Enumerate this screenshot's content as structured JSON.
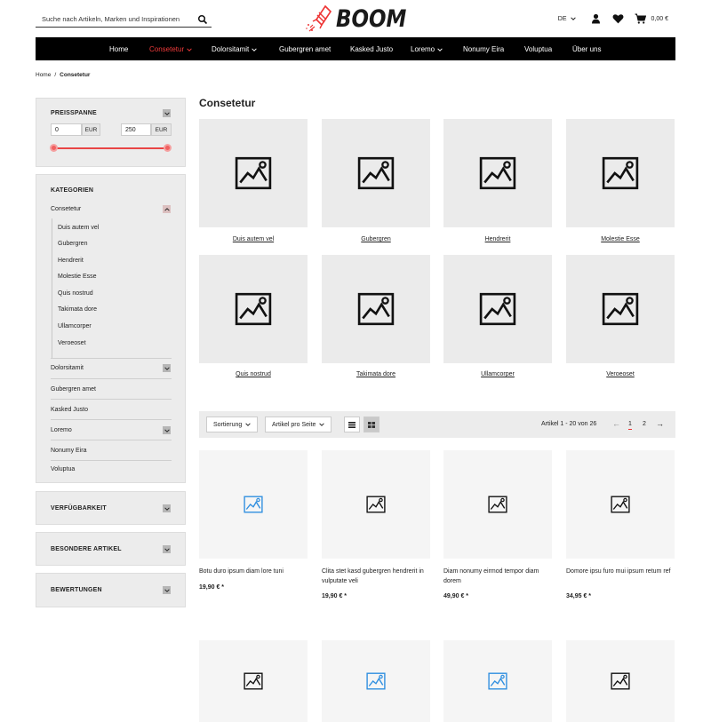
{
  "header": {
    "search_placeholder": "Suche nach Artikeln, Marken und Inspirationen",
    "logo_text": "BOOM",
    "language": "DE",
    "cart_total": "0,00 €"
  },
  "nav": {
    "items": [
      "Home",
      "Consetetur",
      "Dolorsitamit",
      "Gubergren amet",
      "Kasked Justo",
      "Loremo",
      "Nonumy Eira",
      "Voluptua",
      "Über uns"
    ]
  },
  "breadcrumb": {
    "home": "Home",
    "separator": "/",
    "current": "Consetetur"
  },
  "sidebar": {
    "price": {
      "title": "PREISSPANNE",
      "min": "0",
      "max": "250",
      "unit": "EUR",
      "range_fraction": [
        0,
        1
      ]
    },
    "categories": {
      "title": "KATEGORIEN",
      "active": "Consetetur",
      "sub_items": [
        "Duis autem vel",
        "Gubergren",
        "Hendrerit",
        "Molestie Esse",
        "Quis nostrud",
        "Takimata dore",
        "Ullamcorper",
        "Veroeoset"
      ],
      "items": [
        "Dolorsitamit",
        "Gubergren amet",
        "Kasked Justo",
        "Loremo",
        "Nonumy Eira",
        "Voluptua"
      ]
    },
    "filters": [
      "VERFÜGBARKEIT",
      "BESONDERE ARTIKEL",
      "BEWERTUNGEN"
    ]
  },
  "main": {
    "title": "Consetetur",
    "subcategories": [
      "Duis autem vel",
      "Gubergren",
      "Hendrerit",
      "Molestie Esse",
      "Quis nostrud",
      "Takimata dore",
      "Ullamcorper",
      "Veroeoset"
    ],
    "toolbar": {
      "sort_label": "Sortierung",
      "per_page_label": "Artikel pro Seite",
      "count_text": "Artikel 1 - 20 von 26",
      "pages": [
        "1",
        "2"
      ],
      "current_page": "1"
    },
    "products": [
      {
        "name": "Botu duro ipsum diam lore tuni",
        "price": "19,90 € *"
      },
      {
        "name": "Clita stet kasd gubergren hendrerit in vulputate veli",
        "price": "19,90 € *"
      },
      {
        "name": "Diam nonumy eirmod tempor diam dorem",
        "price": "49,90 € *"
      },
      {
        "name": "Domore ipsu furo mui ipsum retum ref",
        "price": "34,95 € *"
      }
    ]
  },
  "colors": {
    "accent": "#f13a3a",
    "nav_bg": "#000000",
    "placeholder_blue": "#2f8fe0"
  }
}
